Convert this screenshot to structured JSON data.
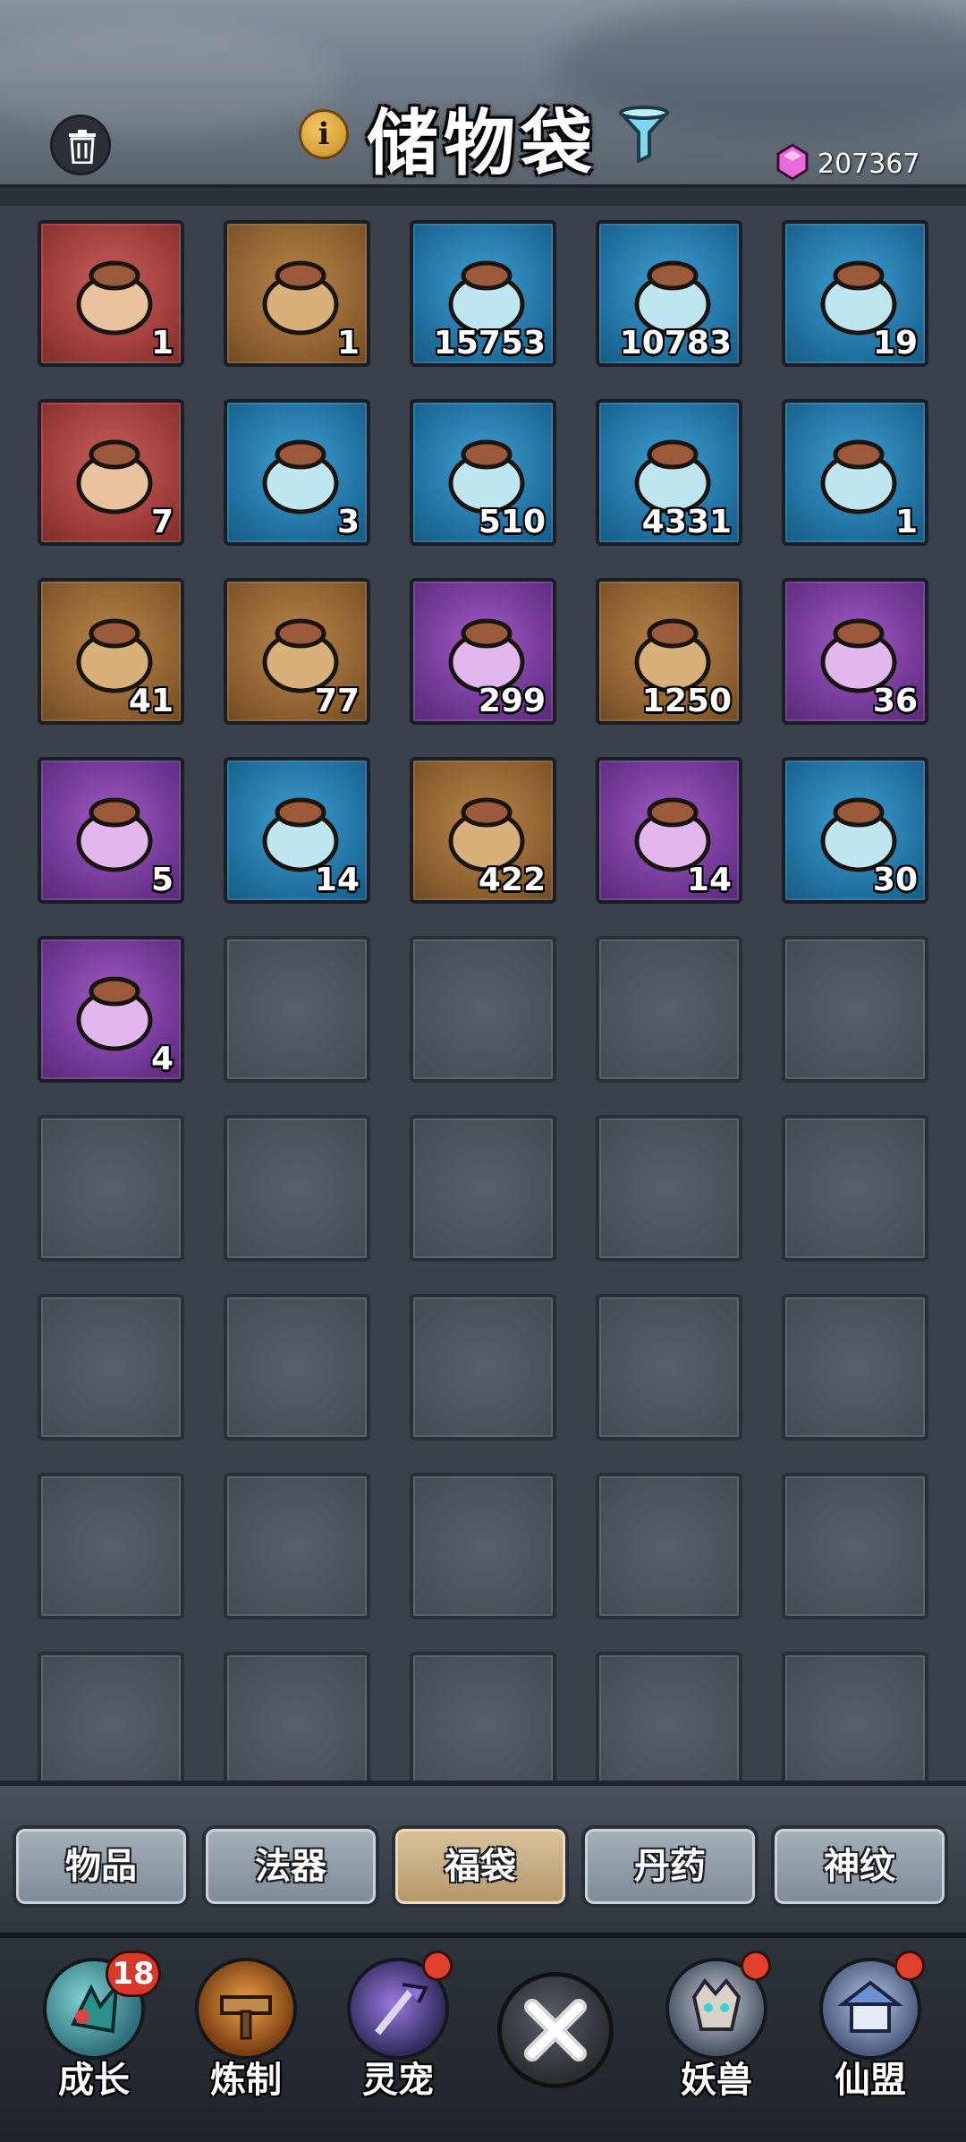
{
  "header": {
    "title": "储物袋",
    "currency_value": "207367",
    "currency_icon": "spirit-stone-gem-icon"
  },
  "items": [
    {
      "qty": "1",
      "rarity": "red",
      "icon": "red-manual-book-icon"
    },
    {
      "qty": "1",
      "rarity": "orange",
      "icon": "jade-pouch-icon"
    },
    {
      "qty": "15753",
      "rarity": "blue",
      "icon": "gourd-sprout-icon"
    },
    {
      "qty": "10783",
      "rarity": "blue",
      "icon": "jade-teapot-icon"
    },
    {
      "qty": "19",
      "rarity": "blue",
      "icon": "bread-bag-icon"
    },
    {
      "qty": "7",
      "rarity": "red",
      "icon": "virtue-book-icon"
    },
    {
      "qty": "3",
      "rarity": "blue",
      "icon": "ore-bag-icon"
    },
    {
      "qty": "510",
      "rarity": "blue",
      "icon": "gem-pot-icon"
    },
    {
      "qty": "4331",
      "rarity": "blue",
      "icon": "scroll-bag-icon"
    },
    {
      "qty": "1",
      "rarity": "blue",
      "icon": "gift-box-icon"
    },
    {
      "qty": "41",
      "rarity": "orange",
      "icon": "fragment-bag-icon"
    },
    {
      "qty": "77",
      "rarity": "orange",
      "icon": "fragment-bag-icon"
    },
    {
      "qty": "299",
      "rarity": "purple",
      "icon": "orb-bag-icon"
    },
    {
      "qty": "1250",
      "rarity": "orange",
      "icon": "rune-bag-icon"
    },
    {
      "qty": "36",
      "rarity": "purple",
      "icon": "orb-bag-icon"
    },
    {
      "qty": "5",
      "rarity": "purple",
      "icon": "fragment-bag-icon"
    },
    {
      "qty": "14",
      "rarity": "blue",
      "icon": "ore-bag-icon"
    },
    {
      "qty": "422",
      "rarity": "orange",
      "icon": "orb-bag-icon"
    },
    {
      "qty": "14",
      "rarity": "purple",
      "icon": "pearl-bag-icon"
    },
    {
      "qty": "30",
      "rarity": "blue",
      "icon": "crystal-ore-icon"
    },
    {
      "qty": "4",
      "rarity": "purple",
      "icon": "small-pouch-icon"
    }
  ],
  "tabs": [
    {
      "label": "物品",
      "active": false
    },
    {
      "label": "法器",
      "active": false
    },
    {
      "label": "福袋",
      "active": true
    },
    {
      "label": "丹药",
      "active": false
    },
    {
      "label": "神纹",
      "active": false
    }
  ],
  "bottom_nav": [
    {
      "label": "成长",
      "badge": "18",
      "icon": "growth-icon"
    },
    {
      "label": "炼制",
      "badge": "",
      "icon": "forge-hammer-icon"
    },
    {
      "label": "灵宠",
      "badge": "dot",
      "icon": "spirit-pet-icon"
    },
    {
      "label": "妖兽",
      "badge": "dot",
      "icon": "demon-beast-icon"
    },
    {
      "label": "仙盟",
      "badge": "dot",
      "icon": "immortal-alliance-icon"
    }
  ]
}
